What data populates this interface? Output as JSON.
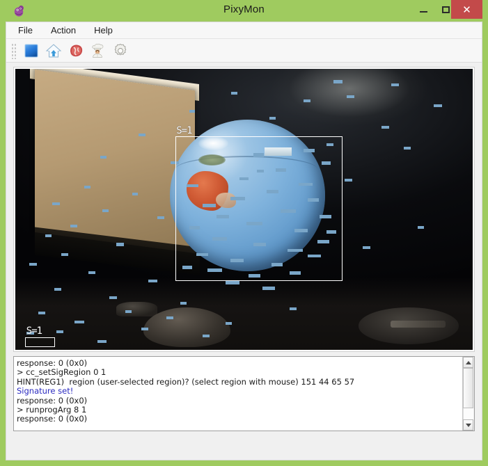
{
  "window": {
    "title": "PixyMon",
    "app_icon": "pixy-bug-icon",
    "accent_color": "#9fcb5f",
    "close_color": "#c34a4a",
    "controls": {
      "minimize": "minimize-icon",
      "maximize": "maximize-icon",
      "close": "✕"
    }
  },
  "menubar": {
    "items": [
      {
        "label": "File",
        "name": "menu-file"
      },
      {
        "label": "Action",
        "name": "menu-action"
      },
      {
        "label": "Help",
        "name": "menu-help"
      }
    ]
  },
  "toolbar": {
    "handle": "drag-handle",
    "buttons": [
      {
        "name": "stop-button",
        "icon": "blue-square-icon",
        "title": "Stop"
      },
      {
        "name": "default-program-button",
        "icon": "home-icon",
        "title": "Default program"
      },
      {
        "name": "raw-video-button",
        "icon": "raw-meat-icon",
        "title": "Raw video"
      },
      {
        "name": "cooked-video-button",
        "icon": "chef-icon",
        "title": "Cooked video"
      },
      {
        "name": "configure-button",
        "icon": "gear-icon",
        "title": "Configure"
      }
    ]
  },
  "video": {
    "signature_label_main": "S=1",
    "signature_label_small": "S=1",
    "box_color": "#ffffff",
    "blob_color": "#7aa6c8",
    "background_color": "#050608",
    "blobs": [
      [
        69.5,
        4.0,
        2.0,
        1.1
      ],
      [
        82.2,
        5.2,
        1.7,
        1.0
      ],
      [
        47.2,
        8.1,
        1.4,
        1.0
      ],
      [
        72.5,
        9.3,
        1.6,
        1.0
      ],
      [
        63.0,
        11.0,
        1.5,
        1.0
      ],
      [
        91.5,
        12.5,
        1.8,
        1.0
      ],
      [
        38.0,
        14.5,
        1.3,
        1.0
      ],
      [
        55.5,
        17.0,
        1.5,
        1.0
      ],
      [
        80.0,
        20.2,
        1.7,
        1.0
      ],
      [
        27.0,
        23.0,
        1.4,
        1.0
      ],
      [
        68.0,
        26.5,
        1.6,
        1.0
      ],
      [
        85.0,
        27.8,
        1.5,
        1.0
      ],
      [
        18.5,
        31.0,
        1.4,
        1.0
      ],
      [
        34.0,
        33.0,
        1.8,
        1.0
      ],
      [
        52.8,
        36.0,
        1.5,
        1.0
      ],
      [
        72.0,
        39.0,
        1.6,
        1.0
      ],
      [
        15.0,
        41.5,
        1.5,
        1.0
      ],
      [
        25.5,
        44.0,
        1.3,
        1.0
      ],
      [
        8.0,
        47.5,
        1.7,
        1.0
      ],
      [
        19.0,
        50.0,
        1.4,
        1.0
      ],
      [
        31.0,
        52.5,
        1.5,
        1.0
      ],
      [
        12.0,
        55.5,
        1.6,
        1.0
      ],
      [
        6.5,
        59.0,
        1.4,
        1.0
      ],
      [
        22.0,
        62.0,
        1.8,
        1.0
      ],
      [
        10.0,
        65.5,
        1.5,
        1.0
      ],
      [
        76.0,
        63.0,
        1.6,
        1.0
      ],
      [
        88.0,
        56.0,
        1.4,
        1.0
      ],
      [
        3.0,
        69.0,
        1.7,
        1.0
      ],
      [
        16.0,
        72.0,
        1.5,
        1.0
      ],
      [
        29.0,
        75.0,
        2.1,
        1.0
      ],
      [
        8.5,
        78.0,
        1.6,
        1.0
      ],
      [
        20.5,
        81.0,
        1.8,
        1.0
      ],
      [
        36.0,
        83.0,
        1.4,
        1.0
      ],
      [
        5.0,
        86.5,
        1.5,
        1.0
      ],
      [
        13.0,
        89.5,
        2.0,
        1.0
      ],
      [
        27.5,
        92.0,
        1.6,
        1.0
      ],
      [
        2.5,
        93.5,
        1.6,
        1.0
      ],
      [
        41.0,
        94.5,
        1.4,
        1.0
      ],
      [
        18.0,
        96.5,
        1.9,
        1.0
      ],
      [
        33.0,
        88.0,
        1.5,
        1.0
      ],
      [
        46.0,
        90.0,
        1.3,
        1.0
      ],
      [
        60.0,
        85.0,
        1.5,
        1.0
      ],
      [
        9.0,
        93.0,
        1.5,
        1.0
      ],
      [
        24.0,
        86.0,
        1.4,
        1.0
      ],
      [
        52.0,
        30.0,
        2.4,
        1.4
      ],
      [
        37.5,
        41.0,
        2.6,
        1.2
      ],
      [
        47.0,
        45.5,
        3.2,
        1.2
      ],
      [
        41.0,
        48.0,
        2.8,
        1.2
      ],
      [
        55.0,
        43.0,
        2.6,
        1.2
      ],
      [
        62.0,
        40.5,
        3.0,
        1.2
      ],
      [
        64.0,
        46.0,
        2.4,
        1.2
      ],
      [
        58.0,
        50.0,
        3.4,
        1.2
      ],
      [
        44.0,
        52.0,
        2.8,
        1.2
      ],
      [
        50.5,
        54.5,
        3.6,
        1.2
      ],
      [
        38.0,
        56.0,
        2.4,
        1.2
      ],
      [
        61.0,
        57.0,
        3.0,
        1.2
      ],
      [
        66.5,
        52.0,
        2.6,
        1.2
      ],
      [
        43.0,
        60.0,
        3.2,
        1.2
      ],
      [
        52.0,
        62.0,
        2.8,
        1.2
      ],
      [
        59.5,
        64.0,
        3.4,
        1.2
      ],
      [
        39.5,
        65.5,
        2.6,
        1.2
      ],
      [
        47.0,
        67.5,
        3.0,
        1.2
      ],
      [
        56.0,
        69.0,
        2.4,
        1.2
      ],
      [
        64.0,
        66.0,
        2.8,
        1.2
      ],
      [
        42.0,
        71.0,
        3.2,
        1.2
      ],
      [
        51.0,
        73.0,
        2.6,
        1.2
      ],
      [
        60.0,
        72.0,
        2.4,
        1.2
      ],
      [
        46.0,
        75.5,
        3.0,
        1.2
      ],
      [
        54.0,
        77.5,
        2.8,
        1.2
      ],
      [
        66.0,
        61.0,
        2.6,
        1.2
      ],
      [
        68.0,
        57.5,
        2.2,
        1.2
      ],
      [
        36.5,
        70.0,
        2.2,
        1.2
      ],
      [
        49.0,
        38.5,
        2.0,
        1.2
      ],
      [
        57.0,
        35.5,
        2.2,
        1.2
      ],
      [
        67.0,
        33.0,
        2.0,
        1.2
      ],
      [
        63.0,
        28.5,
        2.4,
        1.2
      ]
    ]
  },
  "console": {
    "lines": [
      {
        "text": "response: 0 (0x0)",
        "color": "default"
      },
      {
        "text": "> cc_setSigRegion 0 1",
        "color": "default"
      },
      {
        "text": "HINT(REG1)  region (user-selected region)? (select region with mouse) 151 44 65 57",
        "color": "default"
      },
      {
        "text": "Signature set!",
        "color": "blue"
      },
      {
        "text": "response: 0 (0x0)",
        "color": "default"
      },
      {
        "text": "> runprogArg 8 1",
        "color": "default"
      },
      {
        "text": "response: 0 (0x0)",
        "color": "default"
      }
    ],
    "scrollbar": {
      "up_arrow": "scroll-up-icon",
      "down_arrow": "scroll-down-icon"
    }
  }
}
